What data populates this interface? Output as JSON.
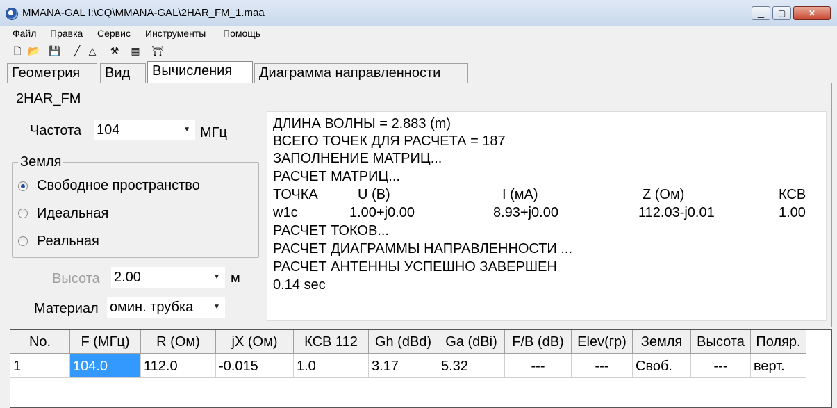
{
  "window": {
    "title": "MMANA-GAL I:\\CQ\\MMANA-GAL\\2HAR_FM_1.maa"
  },
  "window_buttons": {
    "minimize": "▁",
    "maximize": "▢",
    "close": "✕"
  },
  "menu": [
    "Файл",
    "Правка",
    "Сервис",
    "Инструменты",
    "Помощь"
  ],
  "toolbar": [
    {
      "icon": "new-file-icon",
      "glyph": "🗋"
    },
    {
      "icon": "open-folder-icon",
      "glyph": "📂"
    },
    {
      "icon": "save-icon",
      "glyph": "💾"
    },
    {
      "icon": "wire-icon",
      "glyph": "╱"
    },
    {
      "icon": "triangle-icon",
      "glyph": "△"
    },
    {
      "icon": "tools-icon",
      "glyph": "⚒"
    },
    {
      "icon": "calculator-icon",
      "glyph": "▦"
    },
    {
      "icon": "antenna-icon",
      "glyph": "⛩"
    }
  ],
  "tabs": [
    "Геометрия",
    "Вид",
    "Вычисления",
    "Диаграмма направленности"
  ],
  "active_tab": "Вычисления",
  "antenna_name": "2HAR_FM",
  "frequency": {
    "label": "Частота",
    "value": "104",
    "unit": "МГц"
  },
  "ground": {
    "title": "Земля",
    "options": [
      "Свободное пространство",
      "Идеальная",
      "Реальная"
    ],
    "selected": "Свободное пространство"
  },
  "height": {
    "label": "Высота",
    "value": "2.00",
    "unit": "м"
  },
  "material": {
    "label": "Материал",
    "value": "омин. трубка"
  },
  "output": {
    "lines": [
      "ДЛИНА ВОЛНЫ = 2.883 (m)",
      "ВСЕГО ТОЧЕК ДЛЯ РАСЧЕТА = 187",
      "ЗАПОЛНЕНИЕ МАТРИЦ...",
      "РАСЧЕТ МАТРИЦ..."
    ],
    "point_header": [
      "ТОЧКА",
      "U (В)",
      "I (мА)",
      "Z (Ом)",
      "КСВ"
    ],
    "point_row": [
      "w1c",
      "1.00+j0.00",
      "8.93+j0.00",
      "112.03-j0.01",
      "1.00"
    ],
    "lines_after": [
      "РАСЧЕТ ТОКОВ...",
      "РАСЧЕТ ДИАГРАММЫ НАПРАВЛЕННОСТИ ...",
      "РАСЧЕТ АНТЕННЫ УСПЕШНО ЗАВЕРШЕН",
      "0.14 sec"
    ]
  },
  "table": {
    "headers": [
      "No.",
      "F (МГц)",
      "R (Ом)",
      "jX (Ом)",
      "КСВ 112",
      "Gh (dBd)",
      "Ga (dBi)",
      "F/B (dB)",
      "Elev(гр)",
      "Земля",
      "Высота",
      "Поляр."
    ],
    "rows": [
      [
        "1",
        "104.0",
        "112.0",
        "-0.015",
        "1.0",
        "3.17",
        "5.32",
        "---",
        "---",
        "Своб.",
        "---",
        "верт."
      ]
    ]
  },
  "colors": {
    "selection": "#3399ff",
    "radio_dot": "#1c4f9c",
    "close_button": "#c9452f"
  }
}
